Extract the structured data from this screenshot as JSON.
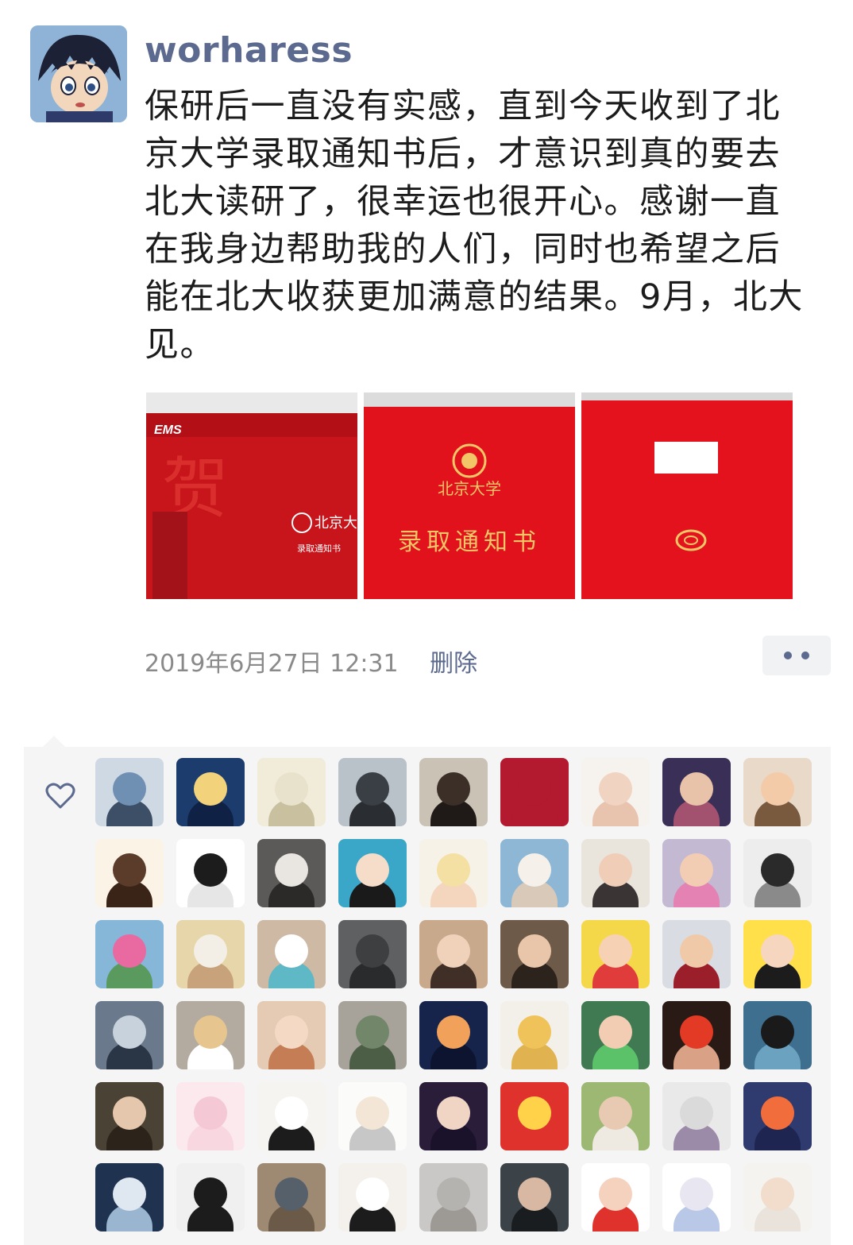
{
  "post": {
    "username": "worharess",
    "text": "保研后一直没有实感，直到今天收到了北\n京大学录取通知书后，才意识到真的要去\n北大读研了，很幸运也很开心。感谢一直\n在我身边帮助我的人们，同时也希望之后\n能在北大收获更加满意的结果。9月，北大\n见。",
    "timestamp": "2019年6月27日 12:31",
    "delete_label": "删除",
    "photos": [
      {
        "caption_brand": "EMS",
        "caption_char": "贺",
        "caption_school": "北京大学",
        "caption_doc": "录取通知书"
      },
      {
        "caption_school": "北京大学",
        "caption_doc": "录取通知书"
      },
      {
        "caption_note": ""
      }
    ]
  },
  "icons": {
    "more": "more-dots-icon",
    "like": "heart-icon"
  },
  "colors": {
    "username": "#5b6a8e",
    "text": "#1c1c1c",
    "meta": "#8a8a8a",
    "panel": "#f5f5f5",
    "envelope_red": "#d8161e"
  },
  "likers": [
    {
      "bg": "#cfd9e4",
      "fg": "#6f8fb3",
      "body": "#3d4f66"
    },
    {
      "bg": "#1d3c6e",
      "fg": "#f2d27a",
      "body": "#0f2245"
    },
    {
      "bg": "#f0ecd9",
      "fg": "#e8e2cc",
      "body": "#c9c0a0"
    },
    {
      "bg": "#b9c2c9",
      "fg": "#3a3f45",
      "body": "#2a2d31"
    },
    {
      "bg": "#c9c2b5",
      "fg": "#3b2f28",
      "body": "#1f1a17"
    },
    {
      "bg": "#b3192f",
      "fg": "#b3192f",
      "body": "#b3192f"
    },
    {
      "bg": "#f6f2ee",
      "fg": "#f0d3c0",
      "body": "#e8c3ae"
    },
    {
      "bg": "#3a2f57",
      "fg": "#e8c3a9",
      "body": "#a2526f"
    },
    {
      "bg": "#e8d9c9",
      "fg": "#f3cba8",
      "body": "#7a5a3f"
    },
    {
      "bg": "#fbf4e6",
      "fg": "#5b3c2a",
      "body": "#3a2418"
    },
    {
      "bg": "#ffffff",
      "fg": "#1c1c1c",
      "body": "#e6e6e6"
    },
    {
      "bg": "#5c5a58",
      "fg": "#e9e6e2",
      "body": "#2c2a28"
    },
    {
      "bg": "#3aa6c8",
      "fg": "#f5ddc9",
      "body": "#1a1a1a"
    },
    {
      "bg": "#f7f2e8",
      "fg": "#f3e0a2",
      "body": "#f4d6bf"
    },
    {
      "bg": "#8db7d4",
      "fg": "#f5f0ea",
      "body": "#d9c9b8"
    },
    {
      "bg": "#e9e4dc",
      "fg": "#f0cdb7",
      "body": "#3a3434"
    },
    {
      "bg": "#c4b9d3",
      "fg": "#f2cdb3",
      "body": "#e482b4"
    },
    {
      "bg": "#ededed",
      "fg": "#2a2a2a",
      "body": "#8a8a8a"
    },
    {
      "bg": "#86b6d8",
      "fg": "#e86aa0",
      "body": "#5b9a5f"
    },
    {
      "bg": "#e6d6a9",
      "fg": "#f4efe6",
      "body": "#c7a27a"
    },
    {
      "bg": "#cdb9a4",
      "fg": "#ffffff",
      "body": "#5fb8c6"
    },
    {
      "bg": "#5e6062",
      "fg": "#3e3f41",
      "body": "#2a2b2c"
    },
    {
      "bg": "#c9a98b",
      "fg": "#f0d2bb",
      "body": "#3f2f27"
    },
    {
      "bg": "#6e5a48",
      "fg": "#e9c6a9",
      "body": "#2c231c"
    },
    {
      "bg": "#f5d84a",
      "fg": "#f6d1b4",
      "body": "#e03c3c"
    },
    {
      "bg": "#d9dde3",
      "fg": "#f0c9a9",
      "body": "#9a1f2a"
    },
    {
      "bg": "#ffe04a",
      "fg": "#f6d6bf",
      "body": "#1c1c1c"
    },
    {
      "bg": "#6a7a8c",
      "fg": "#c8d2dc",
      "body": "#2a3646"
    },
    {
      "bg": "#b3aba0",
      "fg": "#e6c58f",
      "body": "#ffffff"
    },
    {
      "bg": "#e6cbb4",
      "fg": "#f4d9c4",
      "body": "#c57d56"
    },
    {
      "bg": "#a7a39b",
      "fg": "#72866a",
      "body": "#4d5e47"
    },
    {
      "bg": "#16234a",
      "fg": "#f1a15a",
      "body": "#0c1430"
    },
    {
      "bg": "#f3f0ea",
      "fg": "#f0c35a",
      "body": "#e1b350"
    },
    {
      "bg": "#3f7a52",
      "fg": "#f2cdb3",
      "body": "#5cc26a"
    },
    {
      "bg": "#2a1a16",
      "fg": "#e23a24",
      "body": "#d9a287"
    },
    {
      "bg": "#3f6f8f",
      "fg": "#1a1a1a",
      "body": "#6ba2c0"
    },
    {
      "bg": "#4a4234",
      "fg": "#e4c7ad",
      "body": "#2c241a"
    },
    {
      "bg": "#fbe9ee",
      "fg": "#f4c8d4",
      "body": "#f9d7e0"
    },
    {
      "bg": "#f5f4f1",
      "fg": "#ffffff",
      "body": "#1c1c1c"
    },
    {
      "bg": "#fbfbfa",
      "fg": "#f3e6d6",
      "body": "#c7c7c7"
    },
    {
      "bg": "#2a1d3a",
      "fg": "#f0d4c4",
      "body": "#1a122a"
    },
    {
      "bg": "#e0322d",
      "fg": "#ffd24a",
      "body": "#e0322d"
    },
    {
      "bg": "#9cb872",
      "fg": "#e8c9b2",
      "body": "#eeeae2"
    },
    {
      "bg": "#e9e9ea",
      "fg": "#dadada",
      "body": "#9b8aa8"
    },
    {
      "bg": "#2f3b6e",
      "fg": "#f26d3c",
      "body": "#1d2550"
    },
    {
      "bg": "#1f3350",
      "fg": "#dfe7f0",
      "body": "#9ab5cf"
    },
    {
      "bg": "#f0f0f0",
      "fg": "#1c1c1c",
      "body": "#1c1c1c"
    },
    {
      "bg": "#9e8a73",
      "fg": "#55606b",
      "body": "#6b5a48"
    },
    {
      "bg": "#f4f1ec",
      "fg": "#ffffff",
      "body": "#1c1c1c"
    },
    {
      "bg": "#c9c8c6",
      "fg": "#b5b3b0",
      "body": "#9d9a96"
    },
    {
      "bg": "#3b4248",
      "fg": "#d8b8a2",
      "body": "#1a1d20"
    },
    {
      "bg": "#ffffff",
      "fg": "#f4d2be",
      "body": "#e0322d"
    },
    {
      "bg": "#ffffff",
      "fg": "#e8e6f0",
      "body": "#b8c8e6"
    },
    {
      "bg": "#f5f3ef",
      "fg": "#f2dccb",
      "body": "#e9e3dc"
    }
  ]
}
